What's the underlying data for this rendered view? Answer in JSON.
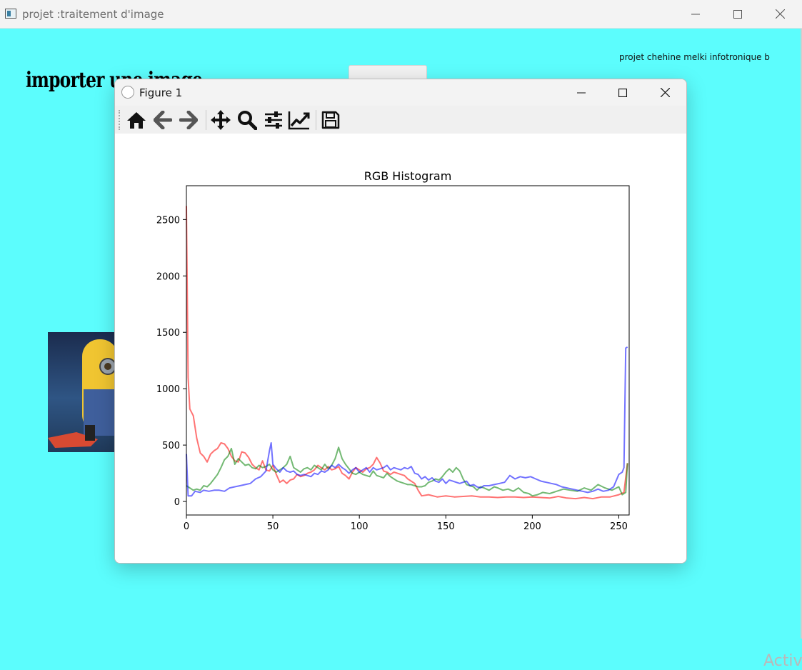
{
  "app": {
    "title": "projet :traitement d'image",
    "author": "projet chehine melki infotronique b",
    "import_label": "importer une image",
    "watermark": "Activ"
  },
  "figure": {
    "title": "Figure 1",
    "toolbar_icons": [
      "home-icon",
      "back-arrow-icon",
      "forward-arrow-icon",
      "pan-icon",
      "zoom-icon",
      "subplots-config-icon",
      "axes-edit-icon",
      "save-icon"
    ]
  },
  "colors": {
    "background": "#5cfdfd",
    "red": "#ff0000",
    "green": "#008000",
    "blue": "#0000ff"
  },
  "chart_data": {
    "type": "line",
    "title": "RGB Histogram",
    "xlabel": "",
    "ylabel": "",
    "xlim": [
      0,
      256
    ],
    "ylim": [
      -120,
      2800
    ],
    "xticks": [
      0,
      50,
      100,
      150,
      200,
      250
    ],
    "yticks": [
      0,
      500,
      1000,
      1500,
      2000,
      2500
    ],
    "grid": false,
    "legend": "none",
    "series": [
      {
        "color": "#ff0000",
        "opacity": 0.55,
        "points": [
          [
            0,
            2620
          ],
          [
            1,
            1100
          ],
          [
            2,
            820
          ],
          [
            4,
            760
          ],
          [
            6,
            560
          ],
          [
            8,
            430
          ],
          [
            10,
            400
          ],
          [
            12,
            350
          ],
          [
            14,
            420
          ],
          [
            16,
            450
          ],
          [
            18,
            470
          ],
          [
            20,
            520
          ],
          [
            22,
            510
          ],
          [
            24,
            470
          ],
          [
            26,
            400
          ],
          [
            28,
            360
          ],
          [
            30,
            350
          ],
          [
            32,
            440
          ],
          [
            34,
            430
          ],
          [
            36,
            390
          ],
          [
            38,
            330
          ],
          [
            40,
            300
          ],
          [
            42,
            280
          ],
          [
            44,
            360
          ],
          [
            46,
            280
          ],
          [
            48,
            270
          ],
          [
            50,
            320
          ],
          [
            52,
            240
          ],
          [
            54,
            170
          ],
          [
            56,
            190
          ],
          [
            58,
            160
          ],
          [
            60,
            190
          ],
          [
            62,
            200
          ],
          [
            64,
            240
          ],
          [
            66,
            220
          ],
          [
            68,
            230
          ],
          [
            70,
            250
          ],
          [
            72,
            260
          ],
          [
            74,
            280
          ],
          [
            76,
            320
          ],
          [
            78,
            300
          ],
          [
            80,
            280
          ],
          [
            82,
            310
          ],
          [
            84,
            280
          ],
          [
            86,
            290
          ],
          [
            88,
            310
          ],
          [
            90,
            250
          ],
          [
            92,
            230
          ],
          [
            94,
            200
          ],
          [
            96,
            260
          ],
          [
            98,
            300
          ],
          [
            100,
            280
          ],
          [
            102,
            260
          ],
          [
            104,
            290
          ],
          [
            106,
            300
          ],
          [
            108,
            330
          ],
          [
            110,
            390
          ],
          [
            112,
            340
          ],
          [
            114,
            270
          ],
          [
            116,
            260
          ],
          [
            118,
            240
          ],
          [
            120,
            260
          ],
          [
            122,
            250
          ],
          [
            124,
            240
          ],
          [
            126,
            230
          ],
          [
            128,
            200
          ],
          [
            130,
            180
          ],
          [
            132,
            160
          ],
          [
            134,
            100
          ],
          [
            136,
            50
          ],
          [
            140,
            60
          ],
          [
            145,
            40
          ],
          [
            150,
            50
          ],
          [
            155,
            40
          ],
          [
            160,
            45
          ],
          [
            165,
            50
          ],
          [
            170,
            40
          ],
          [
            175,
            40
          ],
          [
            180,
            35
          ],
          [
            185,
            40
          ],
          [
            190,
            40
          ],
          [
            195,
            35
          ],
          [
            200,
            40
          ],
          [
            205,
            35
          ],
          [
            210,
            30
          ],
          [
            215,
            45
          ],
          [
            220,
            30
          ],
          [
            225,
            25
          ],
          [
            230,
            35
          ],
          [
            235,
            25
          ],
          [
            240,
            40
          ],
          [
            245,
            40
          ],
          [
            250,
            60
          ],
          [
            253,
            80
          ],
          [
            255,
            340
          ]
        ]
      },
      {
        "color": "#008000",
        "opacity": 0.55,
        "points": [
          [
            0,
            140
          ],
          [
            2,
            120
          ],
          [
            4,
            100
          ],
          [
            6,
            110
          ],
          [
            8,
            100
          ],
          [
            10,
            140
          ],
          [
            12,
            130
          ],
          [
            14,
            160
          ],
          [
            16,
            200
          ],
          [
            18,
            240
          ],
          [
            20,
            300
          ],
          [
            22,
            370
          ],
          [
            24,
            400
          ],
          [
            26,
            470
          ],
          [
            28,
            330
          ],
          [
            30,
            380
          ],
          [
            32,
            350
          ],
          [
            34,
            320
          ],
          [
            36,
            330
          ],
          [
            38,
            300
          ],
          [
            40,
            290
          ],
          [
            42,
            320
          ],
          [
            44,
            300
          ],
          [
            46,
            310
          ],
          [
            48,
            330
          ],
          [
            50,
            280
          ],
          [
            52,
            260
          ],
          [
            54,
            280
          ],
          [
            56,
            300
          ],
          [
            58,
            330
          ],
          [
            60,
            400
          ],
          [
            62,
            300
          ],
          [
            64,
            280
          ],
          [
            66,
            260
          ],
          [
            68,
            290
          ],
          [
            70,
            300
          ],
          [
            72,
            280
          ],
          [
            74,
            320
          ],
          [
            76,
            300
          ],
          [
            78,
            280
          ],
          [
            80,
            330
          ],
          [
            82,
            290
          ],
          [
            84,
            320
          ],
          [
            86,
            380
          ],
          [
            88,
            480
          ],
          [
            90,
            380
          ],
          [
            92,
            330
          ],
          [
            94,
            290
          ],
          [
            96,
            250
          ],
          [
            98,
            240
          ],
          [
            100,
            260
          ],
          [
            102,
            240
          ],
          [
            104,
            230
          ],
          [
            106,
            220
          ],
          [
            108,
            270
          ],
          [
            110,
            230
          ],
          [
            112,
            220
          ],
          [
            114,
            210
          ],
          [
            116,
            250
          ],
          [
            118,
            220
          ],
          [
            120,
            200
          ],
          [
            122,
            180
          ],
          [
            124,
            170
          ],
          [
            126,
            160
          ],
          [
            128,
            150
          ],
          [
            130,
            150
          ],
          [
            132,
            140
          ],
          [
            134,
            130
          ],
          [
            136,
            130
          ],
          [
            138,
            140
          ],
          [
            140,
            170
          ],
          [
            142,
            180
          ],
          [
            144,
            200
          ],
          [
            146,
            190
          ],
          [
            148,
            220
          ],
          [
            150,
            260
          ],
          [
            152,
            290
          ],
          [
            154,
            260
          ],
          [
            156,
            300
          ],
          [
            158,
            270
          ],
          [
            160,
            200
          ],
          [
            162,
            150
          ],
          [
            164,
            140
          ],
          [
            166,
            130
          ],
          [
            168,
            100
          ],
          [
            170,
            130
          ],
          [
            172,
            120
          ],
          [
            175,
            100
          ],
          [
            178,
            130
          ],
          [
            180,
            120
          ],
          [
            183,
            100
          ],
          [
            186,
            110
          ],
          [
            189,
            90
          ],
          [
            192,
            120
          ],
          [
            195,
            80
          ],
          [
            198,
            70
          ],
          [
            200,
            50
          ],
          [
            203,
            60
          ],
          [
            206,
            80
          ],
          [
            210,
            70
          ],
          [
            214,
            90
          ],
          [
            218,
            110
          ],
          [
            222,
            100
          ],
          [
            226,
            90
          ],
          [
            230,
            120
          ],
          [
            234,
            100
          ],
          [
            238,
            150
          ],
          [
            242,
            120
          ],
          [
            246,
            100
          ],
          [
            250,
            130
          ],
          [
            252,
            60
          ],
          [
            254,
            80
          ],
          [
            255,
            340
          ]
        ]
      },
      {
        "color": "#0000ff",
        "opacity": 0.55,
        "points": [
          [
            0,
            420
          ],
          [
            1,
            50
          ],
          [
            3,
            50
          ],
          [
            5,
            90
          ],
          [
            8,
            80
          ],
          [
            10,
            100
          ],
          [
            13,
            90
          ],
          [
            16,
            100
          ],
          [
            19,
            100
          ],
          [
            22,
            90
          ],
          [
            25,
            120
          ],
          [
            28,
            130
          ],
          [
            31,
            140
          ],
          [
            34,
            150
          ],
          [
            37,
            160
          ],
          [
            40,
            200
          ],
          [
            43,
            220
          ],
          [
            46,
            270
          ],
          [
            48,
            450
          ],
          [
            49,
            520
          ],
          [
            50,
            330
          ],
          [
            52,
            290
          ],
          [
            54,
            260
          ],
          [
            56,
            300
          ],
          [
            58,
            270
          ],
          [
            60,
            260
          ],
          [
            62,
            270
          ],
          [
            64,
            240
          ],
          [
            66,
            230
          ],
          [
            68,
            240
          ],
          [
            70,
            230
          ],
          [
            72,
            220
          ],
          [
            74,
            250
          ],
          [
            76,
            240
          ],
          [
            78,
            270
          ],
          [
            80,
            260
          ],
          [
            82,
            280
          ],
          [
            84,
            320
          ],
          [
            86,
            300
          ],
          [
            88,
            330
          ],
          [
            90,
            300
          ],
          [
            92,
            280
          ],
          [
            94,
            250
          ],
          [
            96,
            280
          ],
          [
            98,
            300
          ],
          [
            100,
            260
          ],
          [
            102,
            280
          ],
          [
            104,
            300
          ],
          [
            106,
            260
          ],
          [
            108,
            300
          ],
          [
            110,
            280
          ],
          [
            112,
            290
          ],
          [
            114,
            300
          ],
          [
            116,
            320
          ],
          [
            118,
            280
          ],
          [
            120,
            300
          ],
          [
            122,
            290
          ],
          [
            124,
            280
          ],
          [
            126,
            300
          ],
          [
            128,
            290
          ],
          [
            130,
            310
          ],
          [
            132,
            250
          ],
          [
            134,
            240
          ],
          [
            136,
            200
          ],
          [
            138,
            220
          ],
          [
            140,
            190
          ],
          [
            142,
            210
          ],
          [
            144,
            180
          ],
          [
            146,
            170
          ],
          [
            148,
            200
          ],
          [
            150,
            160
          ],
          [
            152,
            190
          ],
          [
            154,
            180
          ],
          [
            156,
            170
          ],
          [
            158,
            160
          ],
          [
            160,
            170
          ],
          [
            162,
            180
          ],
          [
            164,
            140
          ],
          [
            166,
            150
          ],
          [
            168,
            130
          ],
          [
            170,
            120
          ],
          [
            172,
            140
          ],
          [
            175,
            140
          ],
          [
            178,
            150
          ],
          [
            181,
            160
          ],
          [
            184,
            170
          ],
          [
            187,
            230
          ],
          [
            190,
            200
          ],
          [
            193,
            220
          ],
          [
            196,
            210
          ],
          [
            199,
            220
          ],
          [
            202,
            200
          ],
          [
            205,
            180
          ],
          [
            208,
            170
          ],
          [
            211,
            160
          ],
          [
            214,
            150
          ],
          [
            217,
            130
          ],
          [
            220,
            120
          ],
          [
            223,
            110
          ],
          [
            226,
            100
          ],
          [
            229,
            90
          ],
          [
            232,
            80
          ],
          [
            235,
            90
          ],
          [
            238,
            110
          ],
          [
            241,
            90
          ],
          [
            244,
            100
          ],
          [
            247,
            130
          ],
          [
            250,
            240
          ],
          [
            252,
            260
          ],
          [
            253,
            300
          ],
          [
            254,
            1360
          ],
          [
            255,
            1370
          ]
        ]
      }
    ]
  }
}
